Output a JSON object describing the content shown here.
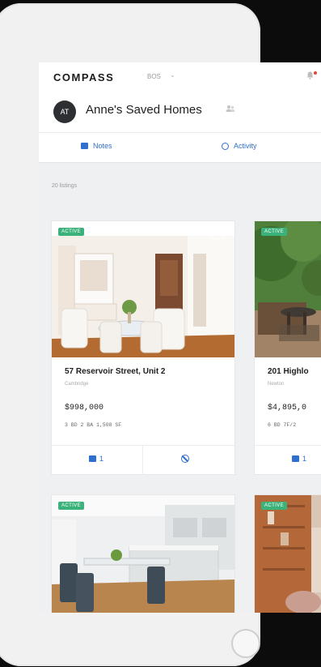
{
  "app": {
    "logo": "COMPASS",
    "location": "BOS",
    "location_caret": "⌄"
  },
  "header": {
    "avatar_initials": "AT",
    "title": "Anne's Saved Homes"
  },
  "tabs": [
    {
      "label": "Notes",
      "icon": "note-icon"
    },
    {
      "label": "Activity",
      "icon": "clock-icon"
    }
  ],
  "listings_count": "20 listings",
  "listings": [
    {
      "status": "ACTIVE",
      "address": "57 Reservoir Street, Unit 2",
      "city": "Cambridge",
      "price": "$998,000",
      "stats": "3 BD   2 BA   1,508 SF",
      "notes_count": "1"
    },
    {
      "status": "ACTIVE",
      "address": "201 Highlo",
      "city": "Newton",
      "price": "$4,895,0",
      "stats": "6 BD   7F/2",
      "notes_count": "1"
    },
    {
      "status": "ACTIVE"
    },
    {
      "status": "ACTIVE"
    }
  ],
  "colors": {
    "accent": "#2f6fd0",
    "badge": "#3bb27a"
  }
}
